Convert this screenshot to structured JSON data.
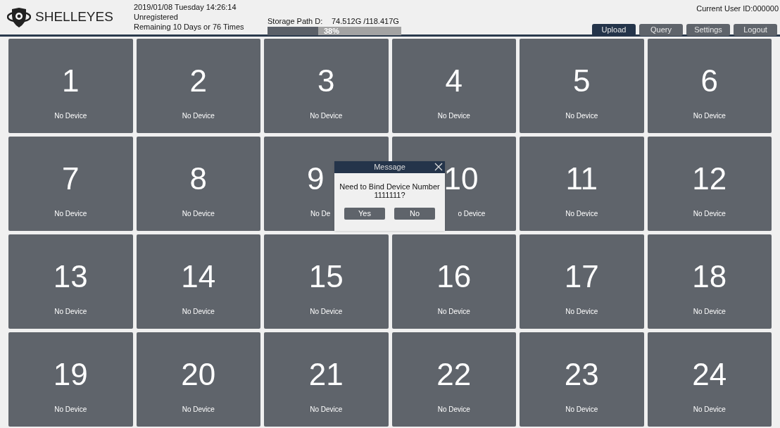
{
  "logo": {
    "text": "SHELLEYES"
  },
  "info": {
    "datetime": "2019/01/08 Tuesday 14:26:14",
    "registration": "Unregistered",
    "remaining": "Remaining 10 Days or 76 Times"
  },
  "storage": {
    "label": "Storage Path D:",
    "value": "74.512G /118.417G",
    "level": 0.38,
    "percent": "38%"
  },
  "user": {
    "text": "Current User ID:000000"
  },
  "buttons": [
    {
      "label": "Upload",
      "selected": true
    },
    {
      "label": "Query",
      "selected": false
    },
    {
      "label": "Settings",
      "selected": false
    },
    {
      "label": "Logout",
      "selected": false
    }
  ],
  "tiles": [
    {
      "number": "1",
      "status": "No Device"
    },
    {
      "number": "2",
      "status": "No Device"
    },
    {
      "number": "3",
      "status": "No Device"
    },
    {
      "number": "4",
      "status": "No Device"
    },
    {
      "number": "5",
      "status": "No Device"
    },
    {
      "number": "6",
      "status": "No Device"
    },
    {
      "number": "7",
      "status": "No Device"
    },
    {
      "number": "8",
      "status": "No Device"
    },
    {
      "number": "9",
      "status": "No De",
      "covered_right": true
    },
    {
      "number": "10",
      "status": "o Device",
      "covered_left": true
    },
    {
      "number": "11",
      "status": "No Device"
    },
    {
      "number": "12",
      "status": "No Device"
    },
    {
      "number": "13",
      "status": "No Device"
    },
    {
      "number": "14",
      "status": "No Device"
    },
    {
      "number": "15",
      "status": "No Device"
    },
    {
      "number": "16",
      "status": "No Device"
    },
    {
      "number": "17",
      "status": "No Device"
    },
    {
      "number": "18",
      "status": "No Device"
    },
    {
      "number": "19",
      "status": "No Device"
    },
    {
      "number": "20",
      "status": "No Device"
    },
    {
      "number": "21",
      "status": "No Device"
    },
    {
      "number": "22",
      "status": "No Device"
    },
    {
      "number": "23",
      "status": "No Device"
    },
    {
      "number": "24",
      "status": "No Device"
    }
  ],
  "dialog": {
    "title": "Message",
    "message": "Need to Bind Device Number 1111111?",
    "buttons": [
      "Yes",
      "No"
    ]
  }
}
